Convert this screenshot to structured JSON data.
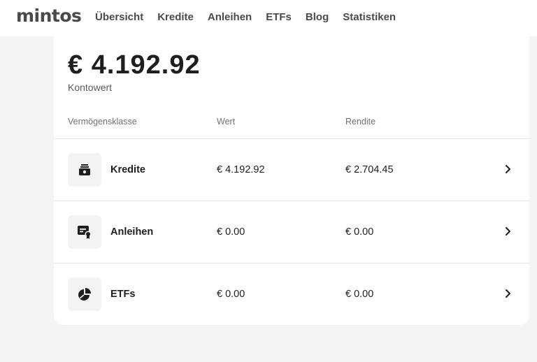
{
  "header": {
    "logo": "mintos",
    "nav": [
      "Übersicht",
      "Kredite",
      "Anleihen",
      "ETFs",
      "Blog",
      "Statistiken"
    ]
  },
  "summary": {
    "balance": "€ 4.192.92",
    "balance_label": "Kontowert"
  },
  "table": {
    "headers": [
      "Vermögensklasse",
      "Wert",
      "Rendite"
    ],
    "rows": [
      {
        "icon": "loan-wallet-icon",
        "name": "Kredite",
        "value": "€ 4.192.92",
        "yield": "€ 2.704.45"
      },
      {
        "icon": "bond-certificate-icon",
        "name": "Anleihen",
        "value": "€ 0.00",
        "yield": "€ 0.00"
      },
      {
        "icon": "etf-pie-icon",
        "name": "ETFs",
        "value": "€ 0.00",
        "yield": "€ 0.00"
      }
    ]
  }
}
